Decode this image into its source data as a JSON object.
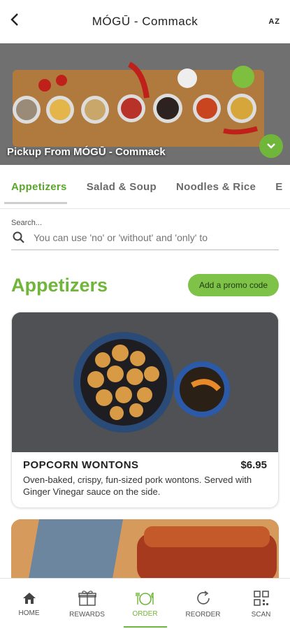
{
  "header": {
    "back_icon": "chevron-left-icon",
    "title": "MÓGŪ - Commack",
    "lang": "AZ"
  },
  "hero": {
    "pickup_text": "Pickup From MÓGŪ - Commack",
    "toggle_icon": "chevron-down-icon"
  },
  "tabs": [
    {
      "label": "Appetizers",
      "active": true
    },
    {
      "label": "Salad & Soup"
    },
    {
      "label": "Noodles & Rice"
    },
    {
      "label": "E"
    }
  ],
  "search": {
    "label": "Search...",
    "placeholder": "You can use 'no' or 'without' and 'only' to"
  },
  "section": {
    "title": "Appetizers",
    "promo_label": "Add a promo code"
  },
  "items": [
    {
      "name": "POPCORN WONTONS",
      "price": "$6.95",
      "description": "Oven-baked, crispy, fun-sized pork wontons. Served with Ginger Vinegar sauce on the side."
    }
  ],
  "nav": [
    {
      "label": "HOME",
      "icon": "home-icon"
    },
    {
      "label": "REWARDS",
      "icon": "gift-icon"
    },
    {
      "label": "ORDER",
      "icon": "dining-icon",
      "active": true
    },
    {
      "label": "REORDER",
      "icon": "refresh-icon"
    },
    {
      "label": "SCAN",
      "icon": "qr-icon"
    }
  ],
  "colors": {
    "accent": "#6fb63a",
    "promo_bg": "#7ec348"
  }
}
